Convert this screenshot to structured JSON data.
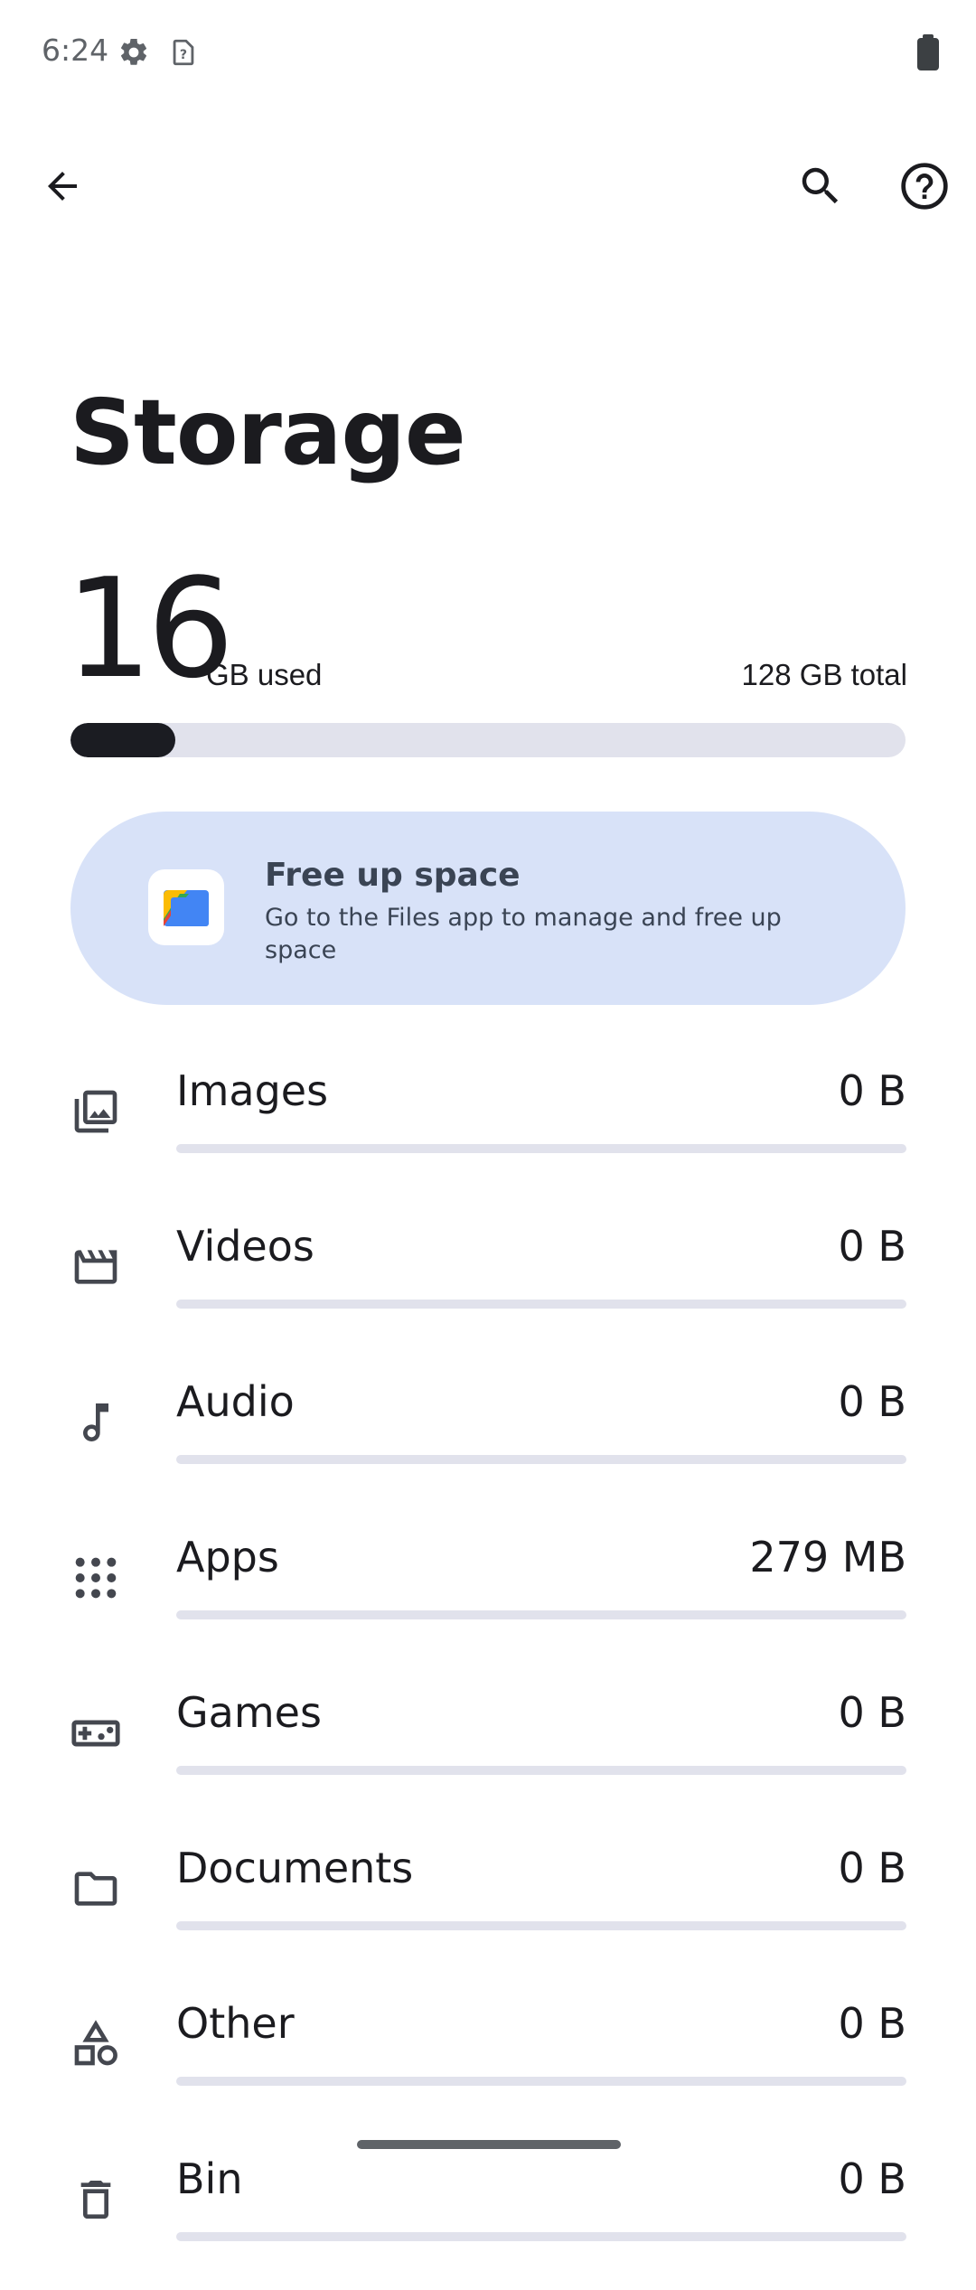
{
  "status_bar": {
    "time": "6:24",
    "icons": [
      "settings-gear-icon",
      "unknown-sim-icon",
      "battery-icon"
    ]
  },
  "app_bar": {
    "back_icon": "arrow-back-icon",
    "search_icon": "search-icon",
    "help_icon": "help-circle-icon"
  },
  "page": {
    "title": "Storage"
  },
  "summary": {
    "used_value": "16",
    "used_unit": "GB used",
    "total": "128 GB total",
    "used_fraction": 0.125,
    "bar_color": "#1b1c22",
    "track_color": "#e1e2ec"
  },
  "free_up_card": {
    "title": "Free up space",
    "description": "Go to the Files app to manage and free up space",
    "icon": "files-app-icon",
    "background": "#d8e2f8"
  },
  "categories": [
    {
      "name": "Images",
      "size": "0 B",
      "icon": "image-gallery-icon",
      "fraction": 0
    },
    {
      "name": "Videos",
      "size": "0 B",
      "icon": "movie-clapper-icon",
      "fraction": 0
    },
    {
      "name": "Audio",
      "size": "0 B",
      "icon": "music-note-icon",
      "fraction": 0
    },
    {
      "name": "Apps",
      "size": "279 MB",
      "icon": "apps-grid-icon",
      "fraction": 0
    },
    {
      "name": "Games",
      "size": "0 B",
      "icon": "gamepad-icon",
      "fraction": 0
    },
    {
      "name": "Documents",
      "size": "0 B",
      "icon": "folder-icon",
      "fraction": 0
    },
    {
      "name": "Other",
      "size": "0 B",
      "icon": "shapes-icon",
      "fraction": 0
    },
    {
      "name": "Bin",
      "size": "0 B",
      "icon": "trash-icon",
      "fraction": 0
    }
  ]
}
